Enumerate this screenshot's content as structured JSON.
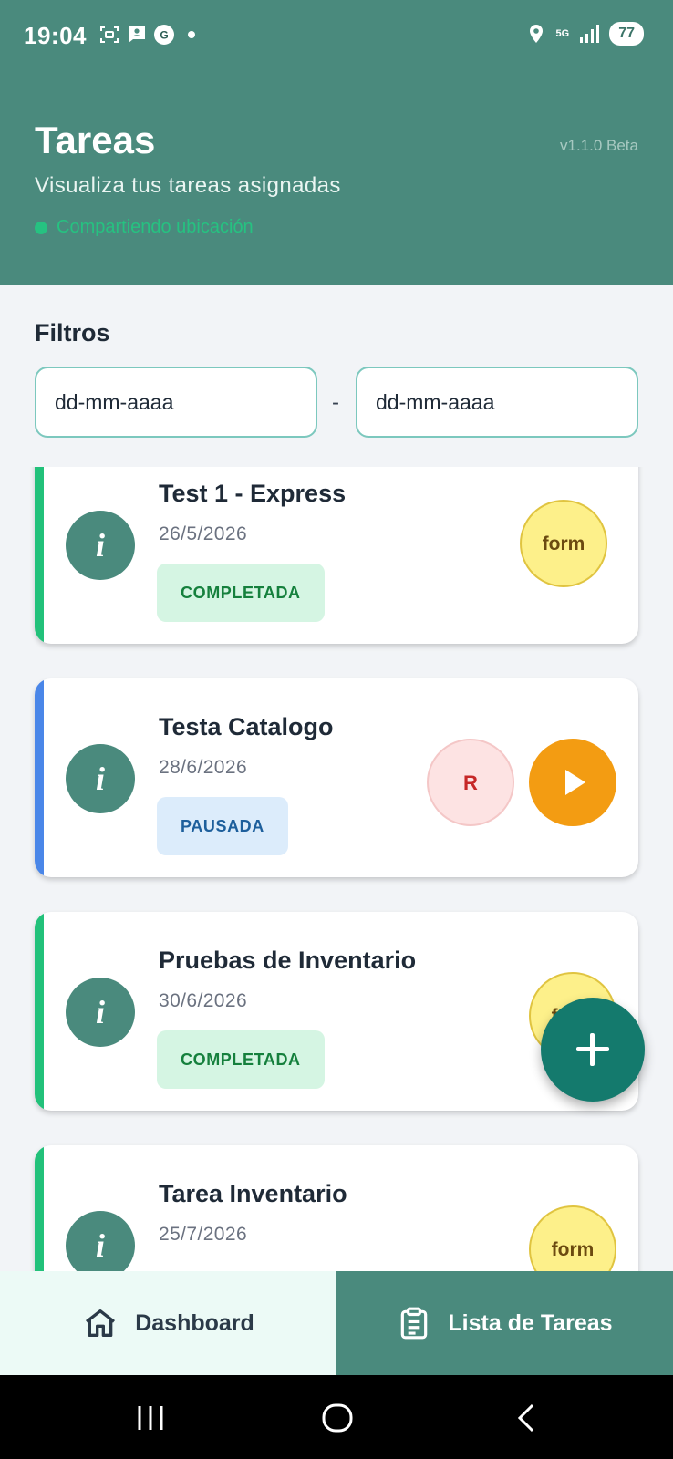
{
  "status_bar": {
    "time": "19:04",
    "network": "5G",
    "battery": "77"
  },
  "header": {
    "title": "Tareas",
    "version": "v1.1.0 Beta",
    "subtitle": "Visualiza tus tareas asignadas",
    "location_status": "Compartiendo ubicación"
  },
  "filters": {
    "label": "Filtros",
    "date_from_placeholder": "dd-mm-aaaa",
    "date_to_placeholder": "dd-mm-aaaa",
    "separator": "-"
  },
  "tasks": [
    {
      "title": "Test 1 - Express",
      "date": "26/5/2026",
      "status": "COMPLETADA",
      "accent": "#22c17a",
      "actions": [
        "form"
      ]
    },
    {
      "title": "Testa Catalogo",
      "date": "28/6/2026",
      "status": "PAUSADA",
      "accent": "#4a86e8",
      "actions": [
        "R",
        "play"
      ]
    },
    {
      "title": "Pruebas de Inventario",
      "date": "30/6/2026",
      "status": "COMPLETADA",
      "accent": "#22c17a",
      "actions": [
        "form"
      ]
    },
    {
      "title": "Tarea Inventario",
      "date": "25/7/2026",
      "status": "",
      "accent": "#22c17a",
      "actions": [
        "form"
      ]
    }
  ],
  "info_glyph": "i",
  "fab_icon": "plus-icon",
  "bottom_nav": {
    "dashboard_label": "Dashboard",
    "task_list_label": "Lista de Tareas"
  },
  "colors": {
    "primary": "#4a8a7d",
    "fab": "#147a6d",
    "completed_bg": "#d5f5e3",
    "paused_bg": "#dcecfb",
    "form_button": "#fdf08a",
    "play_button": "#f39c12"
  }
}
